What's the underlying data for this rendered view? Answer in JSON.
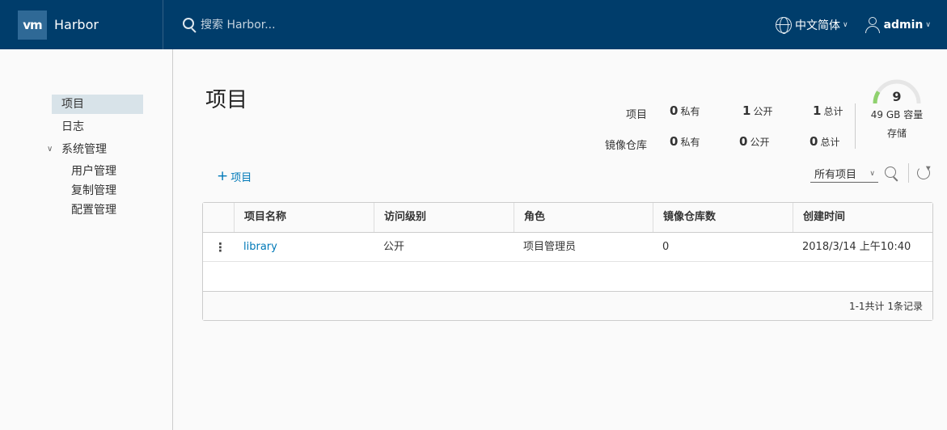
{
  "header": {
    "logo_text": "vm",
    "app_name": "Harbor",
    "search_placeholder": "搜索 Harbor...",
    "language": "中文简体",
    "user": "admin"
  },
  "sidebar": {
    "items": [
      {
        "label": "项目",
        "active": true
      },
      {
        "label": "日志"
      },
      {
        "label": "系统管理",
        "expanded": true,
        "children": [
          {
            "label": "用户管理"
          },
          {
            "label": "复制管理"
          },
          {
            "label": "配置管理"
          }
        ]
      }
    ]
  },
  "main": {
    "title": "项目",
    "stats": {
      "rows": [
        {
          "label": "项目",
          "private_count": "0",
          "private_label": "私有",
          "public_count": "1",
          "public_label": "公开",
          "total_count": "1",
          "total_label": "总计"
        },
        {
          "label": "镜像仓库",
          "private_count": "0",
          "private_label": "私有",
          "public_count": "0",
          "public_label": "公开",
          "total_count": "0",
          "total_label": "总计"
        }
      ]
    },
    "storage": {
      "value": "9",
      "capacity_label": "49 GB 容量",
      "sub_label": "存储",
      "used_fraction": 0.18,
      "used_color": "#8fd16e"
    },
    "add_project_label": "项目",
    "filter": {
      "selected": "所有项目"
    },
    "table": {
      "columns": [
        "项目名称",
        "访问级别",
        "角色",
        "镜像仓库数",
        "创建时间"
      ],
      "rows": [
        {
          "name": "library",
          "access": "公开",
          "role": "项目管理员",
          "repos": "0",
          "created": "2018/3/14 上午10:40"
        }
      ],
      "footer": "1-1共计 1条记录"
    }
  }
}
